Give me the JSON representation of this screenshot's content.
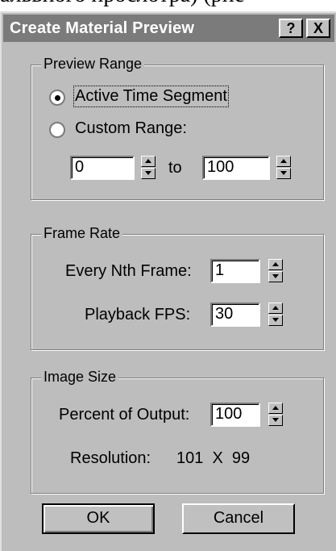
{
  "background_text": "альвного прослотра) (рис",
  "window": {
    "title": "Create Material Preview",
    "help_label": "?",
    "close_label": "X"
  },
  "preview_range": {
    "legend": "Preview Range",
    "option_active": "Active Time Segment",
    "option_custom": "Custom Range:",
    "selected": "Active Time Segment",
    "from_value": "0",
    "to_label": "to",
    "to_value": "100"
  },
  "frame_rate": {
    "legend": "Frame Rate",
    "every_nth_label": "Every Nth Frame:",
    "every_nth_value": "1",
    "playback_fps_label": "Playback FPS:",
    "playback_fps_value": "30"
  },
  "image_size": {
    "legend": "Image Size",
    "percent_label": "Percent of Output:",
    "percent_value": "100",
    "resolution_label": "Resolution:",
    "resolution_value": "101  X  99"
  },
  "buttons": {
    "ok_label": "OK",
    "cancel_label": "Cancel"
  },
  "colors": {
    "dialog_face": "#bdbdbd",
    "titlebar": "#7b7b7b"
  }
}
